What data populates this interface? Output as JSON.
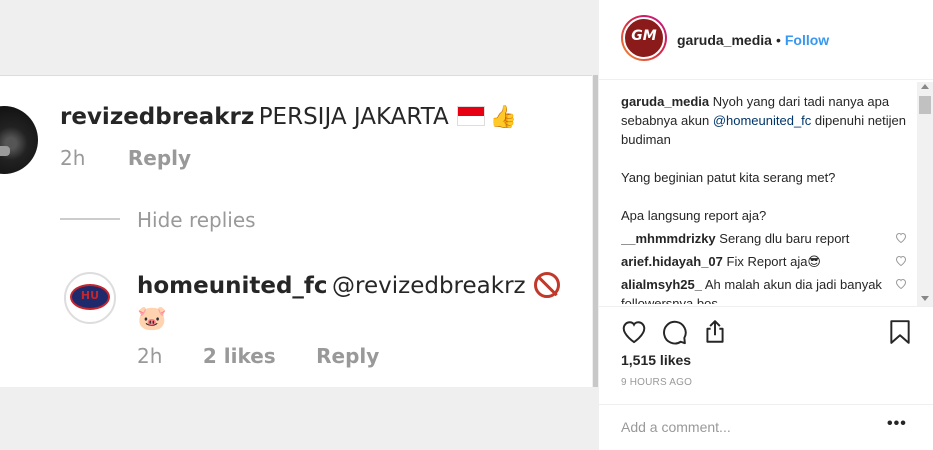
{
  "screenshot": {
    "comment1": {
      "username": "revizedbreakrz",
      "text": "PERSIJA JAKARTA",
      "time": "2h",
      "reply": "Reply"
    },
    "hide_replies": "Hide replies",
    "comment2": {
      "username": "homeunited_fc",
      "text": "@revizedbreakrz",
      "emoji": "🐷",
      "time": "2h",
      "likes": "2 likes",
      "reply": "Reply"
    }
  },
  "post": {
    "username": "garuda_media",
    "dot": "•",
    "follow": "Follow",
    "avatar_logo": "GM",
    "caption": {
      "username": "garuda_media",
      "text_before": "Nyoh yang dari tadi nanya apa sebabnya akun",
      "mention": "@homeunited_fc",
      "text_after": "dipenuhi netijen budiman",
      "line2": "Yang beginian patut kita serang met?",
      "line3": "Apa langsung report aja?"
    },
    "comments": [
      {
        "username": "__mhmmdrizky",
        "text": "Serang dlu baru report"
      },
      {
        "username": "arief.hidayah_07",
        "text": "Fix Report aja😎"
      },
      {
        "username": "alialmsyh25_",
        "text": "Ah malah akun dia jadi banyak followersnya bos,"
      }
    ],
    "likes": "1,515 likes",
    "time_ago": "9 HOURS AGO",
    "add_comment_placeholder": "Add a comment...",
    "more": "•••"
  },
  "colors": {
    "link": "#3897f0",
    "mention": "#003569",
    "brand": "#8b1a1a",
    "flag_red": "#e70011",
    "flag_white": "#ffffff"
  },
  "icons": [
    "heart-icon",
    "comment-icon",
    "share-icon",
    "bookmark-icon",
    "more-icon"
  ]
}
